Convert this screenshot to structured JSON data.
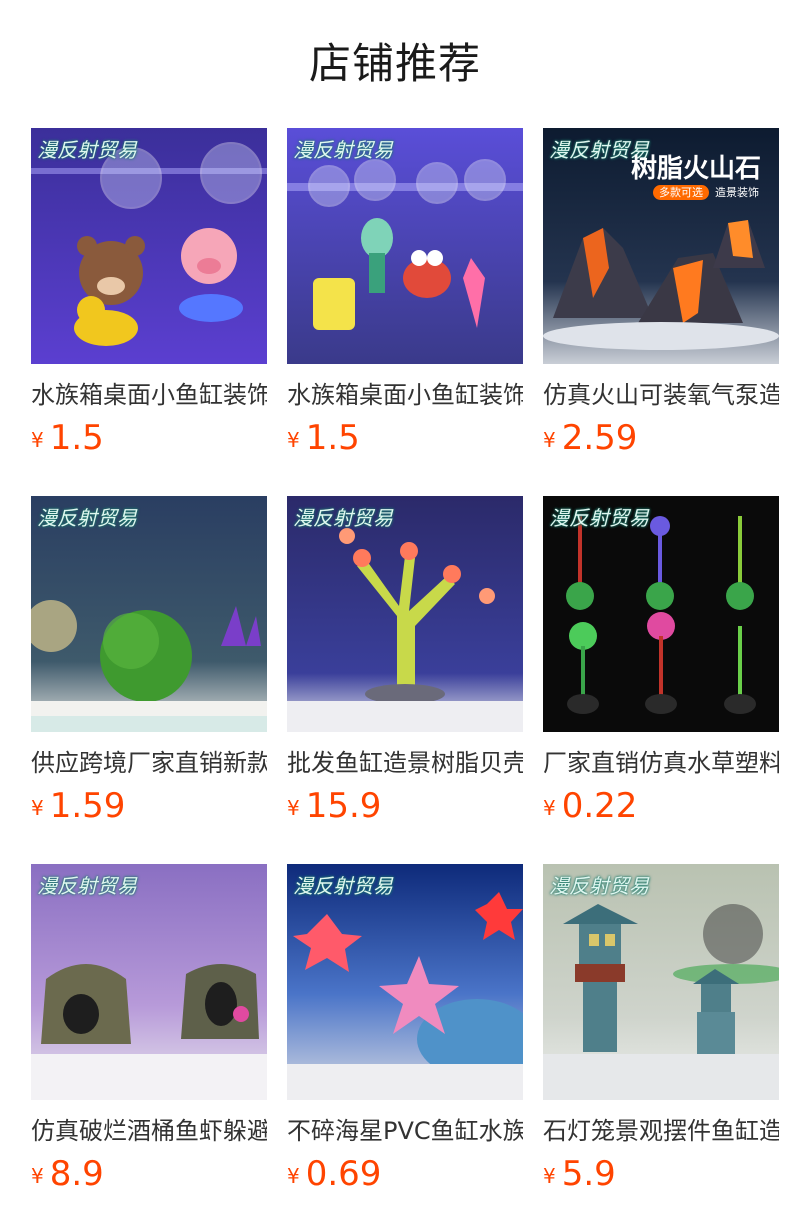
{
  "page": {
    "title": "店铺推荐"
  },
  "watermark": "漫反射贸易",
  "volcano_hero": {
    "headline": "树脂火山石",
    "tag_1": "多款可选",
    "tag_2": "造景装饰"
  },
  "products": [
    {
      "name": "水族箱桌面小鱼缸装饰",
      "currency": "¥",
      "price": "1.5",
      "icon": "cartoon-bear-pig-float-image"
    },
    {
      "name": "水族箱桌面小鱼缸装饰",
      "currency": "¥",
      "price": "1.5",
      "icon": "cartoon-sponge-float-image"
    },
    {
      "name": "仿真火山可装氧气泵造景",
      "currency": "¥",
      "price": "2.59",
      "icon": "resin-volcano-image"
    },
    {
      "name": "供应跨境厂家直销新款",
      "currency": "¥",
      "price": "1.59",
      "icon": "moss-ball-image"
    },
    {
      "name": "批发鱼缸造景树脂贝壳",
      "currency": "¥",
      "price": "15.9",
      "icon": "resin-coral-image"
    },
    {
      "name": "厂家直销仿真水草塑料",
      "currency": "¥",
      "price": "0.22",
      "icon": "artificial-plants-image"
    },
    {
      "name": "仿真破烂酒桶鱼虾躲避",
      "currency": "¥",
      "price": "8.9",
      "icon": "broken-barrel-image"
    },
    {
      "name": "不碎海星PVC鱼缸水族",
      "currency": "¥",
      "price": "0.69",
      "icon": "starfish-image"
    },
    {
      "name": "石灯笼景观摆件鱼缸造景",
      "currency": "¥",
      "price": "5.9",
      "icon": "stone-lantern-image"
    }
  ]
}
